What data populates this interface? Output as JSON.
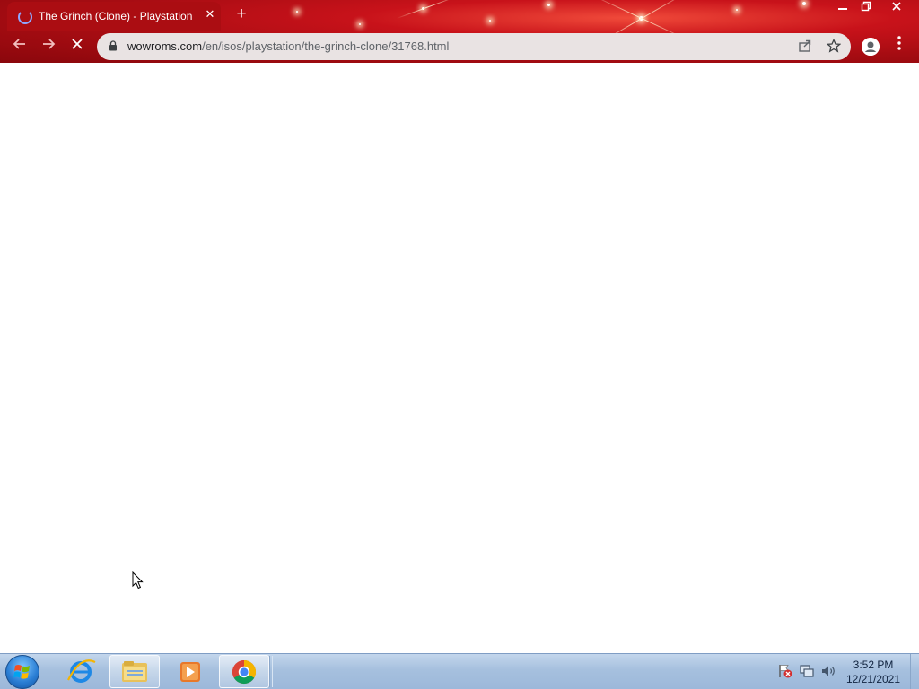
{
  "browser": {
    "tab": {
      "title": "The Grinch (Clone) - Playstation"
    },
    "address_bar": {
      "host": "wowroms.com",
      "path": "/en/isos/playstation/the-grinch-clone/31768.html"
    },
    "icons": [
      "back-icon",
      "forward-icon",
      "stop-icon",
      "lock-icon",
      "share-icon",
      "bookmark-star-icon",
      "profile-icon",
      "menu-icon"
    ],
    "theme_color": "#b3101a"
  },
  "taskbar": {
    "pinned": [
      "internet-explorer",
      "windows-explorer",
      "media-player",
      "google-chrome"
    ],
    "clock": {
      "time": "3:52 PM",
      "date": "12/21/2021"
    }
  }
}
